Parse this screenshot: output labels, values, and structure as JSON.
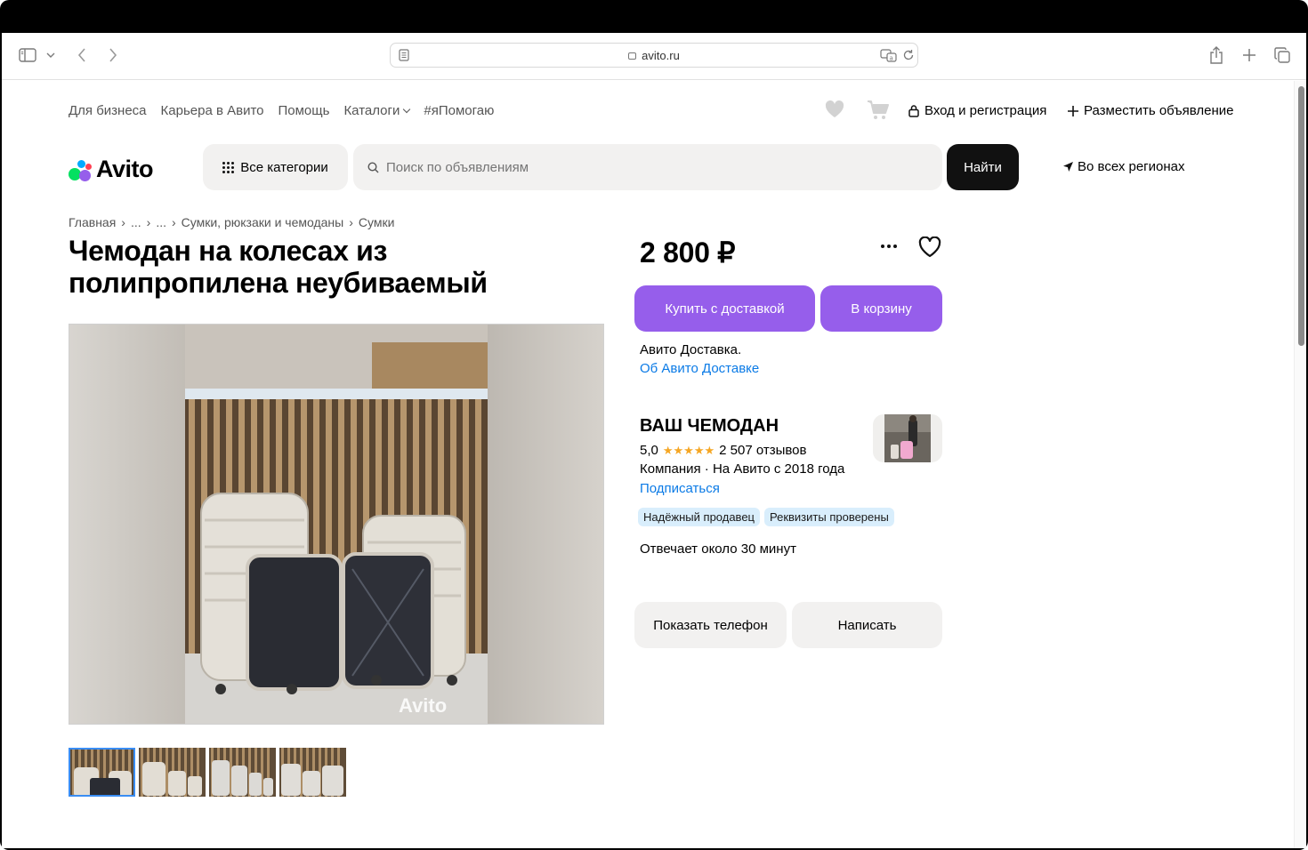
{
  "browser": {
    "url": "avito.ru"
  },
  "header": {
    "links": [
      "Для бизнеса",
      "Карьера в Авито",
      "Помощь",
      "Каталоги",
      "#яПомогаю"
    ],
    "login_label": "Вход и регистрация",
    "place_ad_label": "Разместить объявление",
    "logo_text": "Avito",
    "categories_label": "Все категории",
    "search_placeholder": "Поиск по объявлениям",
    "search_button": "Найти",
    "region_label": "Во всех регионах"
  },
  "breadcrumbs": [
    "Главная",
    "...",
    "...",
    "Сумки, рюкзаки и чемоданы",
    "Сумки"
  ],
  "listing": {
    "title": "Чемодан на колесах из полипропилена неубиваемый",
    "price": "2 800 ₽",
    "watermark": "Avito",
    "thumbnail_count": 4,
    "buy_button": "Купить с доставкой",
    "cart_button": "В корзину",
    "delivery_text": "Авито Доставка.",
    "delivery_link": "Об Авито Доставке"
  },
  "seller": {
    "name": "ВАШ ЧЕМОДАН",
    "rating": "5,0",
    "stars": 5,
    "reviews": "2 507 отзывов",
    "company_info": "Компания · На Авито с 2018 года",
    "subscribe_label": "Подписаться",
    "badges": [
      "Надёжный продавец",
      "Реквизиты проверены"
    ],
    "response_time": "Отвечает около 30 минут",
    "phone_button": "Показать телефон",
    "write_button": "Написать"
  },
  "colors": {
    "accent_purple": "#965eeb",
    "link_blue": "#0a7ae6",
    "dark_button": "#111111",
    "badge_bg": "#d9eefc",
    "star": "#f5a623"
  }
}
